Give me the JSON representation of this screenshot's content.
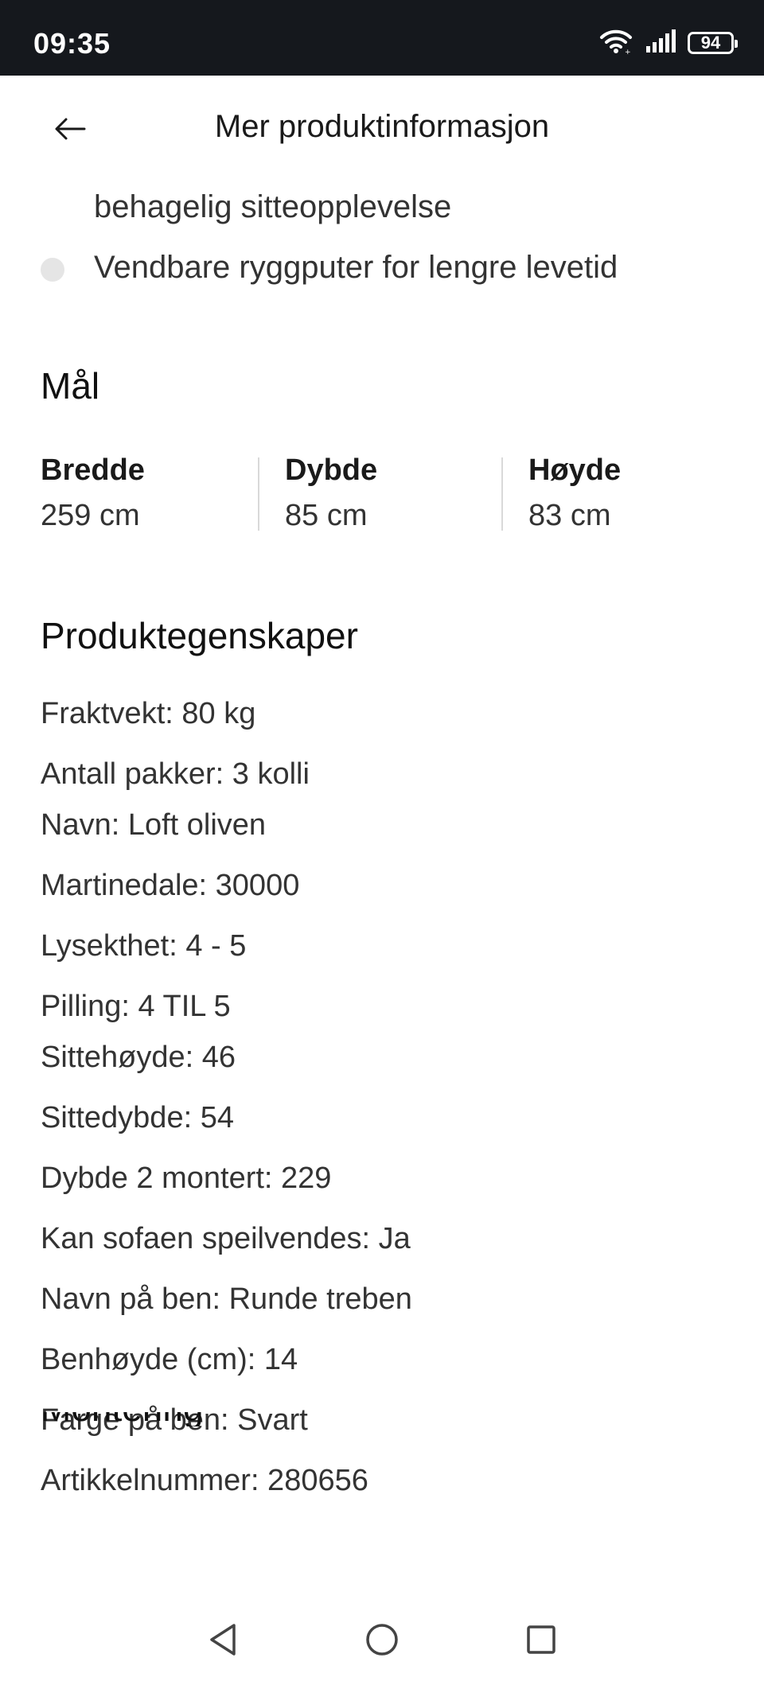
{
  "status_bar": {
    "time": "09:35",
    "battery": "94",
    "icons": [
      "wifi-icon",
      "signal-icon",
      "battery-icon"
    ]
  },
  "header": {
    "title": "Mer produktinformasjon",
    "back_icon": "arrow-left-icon"
  },
  "features": {
    "partial_line": "behagelig sitteopplevelse",
    "items": [
      "Vendbare ryggputer for lengre levetid"
    ]
  },
  "dimensions": {
    "title": "Mål",
    "items": [
      {
        "label": "Bredde",
        "value": "259 cm"
      },
      {
        "label": "Dybde",
        "value": "85 cm"
      },
      {
        "label": "Høyde",
        "value": "83 cm"
      }
    ]
  },
  "properties": {
    "title": "Produktegenskaper",
    "items": [
      "Fraktvekt: 80 kg",
      "Antall pakker: 3 kolli",
      "Navn: Loft oliven",
      "Martinedale: 30000",
      "Lysekthet: 4 - 5",
      "Pilling: 4 TIL 5",
      "Sittehøyde: 46",
      "Sittedybde: 54",
      "Dybde 2 montert: 229",
      "Kan sofaen speilvendes: Ja",
      "Navn på ben: Runde treben",
      "Benhøyde (cm): 14",
      "Farge på ben: Svart",
      "Artikkelnummer: 280656"
    ]
  },
  "next_section_partial": "Montering",
  "nav_bar": {
    "icons": [
      "back-triangle-icon",
      "home-circle-icon",
      "recents-square-icon"
    ]
  }
}
